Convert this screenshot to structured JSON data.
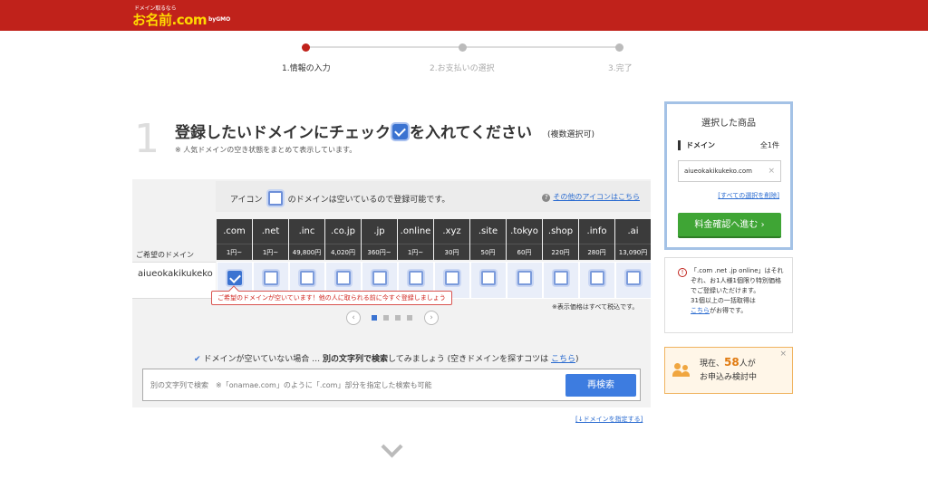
{
  "header": {
    "logo_tagline": "ドメイン取るなら",
    "logo_main": "お名前.com",
    "logo_gmo": "byGMO"
  },
  "steps": [
    {
      "label": "1.情報の入力",
      "active": true
    },
    {
      "label": "2.お支払いの選択",
      "active": false
    },
    {
      "label": "3.完了",
      "active": false
    }
  ],
  "section": {
    "number": "1",
    "title_before": "登録したいドメインにチェック",
    "title_after": "を入れてください",
    "multi": "(複数選択可)",
    "subnote": "※ 人気ドメインの空き状態をまとめて表示しています。"
  },
  "legend": {
    "prefix": "アイコン",
    "suffix": "のドメインは空いているので登録可能です。",
    "other_link": "その他のアイコンはこちら"
  },
  "table": {
    "wanted_label": "ご希望のドメイン",
    "domain_name": "aiueokakikukeko",
    "tlds": [
      {
        "name": ".com",
        "price": "1円~",
        "checked": true
      },
      {
        "name": ".net",
        "price": "1円~",
        "checked": false
      },
      {
        "name": ".inc",
        "price": "49,800円",
        "checked": false
      },
      {
        "name": ".co.jp",
        "price": "4,020円",
        "checked": false
      },
      {
        "name": ".jp",
        "price": "360円~",
        "checked": false
      },
      {
        "name": ".online",
        "price": "1円~",
        "checked": false
      },
      {
        "name": ".xyz",
        "price": "30円",
        "checked": false
      },
      {
        "name": ".site",
        "price": "50円",
        "checked": false
      },
      {
        "name": ".tokyo",
        "price": "60円",
        "checked": false
      },
      {
        "name": ".shop",
        "price": "220円",
        "checked": false
      },
      {
        "name": ".info",
        "price": "280円",
        "checked": false
      },
      {
        "name": ".ai",
        "price": "13,090円",
        "checked": false
      }
    ],
    "tooltip": "ご希望のドメインが空いています！他の人に取られる前に今すぐ登録しましょう",
    "tax_note": "※表示価格はすべて税込です。"
  },
  "pager": {
    "prev": "‹",
    "next": "›",
    "page_count": 4,
    "current": 1
  },
  "search": {
    "hint_prefix": "ドメインが空いていない場合 … ",
    "hint_bold": "別の文字列で検索",
    "hint_mid": "してみましょう (空きドメインを探すコツは ",
    "hint_link": "こちら",
    "hint_suffix": ")",
    "placeholder": "別の文字列で検索　※「onamae.com」のように「.com」部分を指定した検索も可能",
    "button": "再検索",
    "specify_link": "[↓ドメインを指定する]"
  },
  "cart": {
    "title": "選択した商品",
    "section": "ドメイン",
    "count": "全1件",
    "item": "aiueokakikukeko.com",
    "remove_all": "[すべての選択を削除]",
    "proceed": "料金確認へ進む ›"
  },
  "notice": {
    "text": "「.com .net .jp online」はそれぞれ、お1人様1個限り特別価格でご登録いただけます。",
    "text2": "31個以上の一括取得は",
    "link": "こちら",
    "text3": "がお得です。"
  },
  "viewers": {
    "prefix": "現在、",
    "count": "58",
    "unit": "人が",
    "line2": "お申込み検討中",
    "close": "×"
  },
  "colors": {
    "brand_red": "#c0221b",
    "accent_blue": "#3b73d1",
    "proceed_green": "#3fa535",
    "viewer_orange": "#e07a10"
  }
}
